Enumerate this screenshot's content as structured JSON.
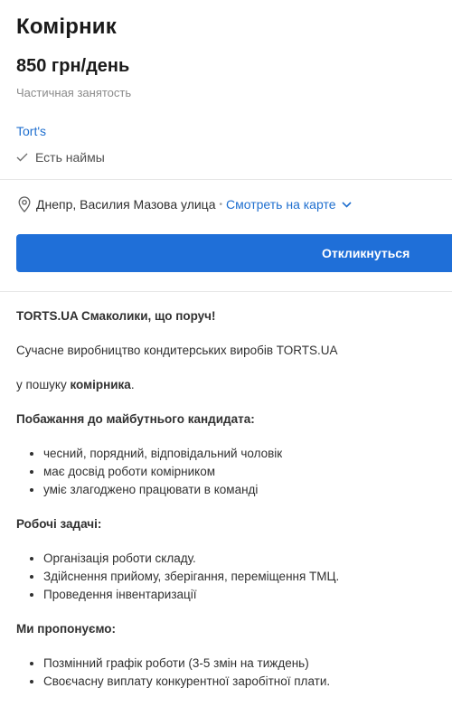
{
  "vacancy": {
    "title": "Комірник",
    "salary": "850 грн/день",
    "employment": "Частичная занятость",
    "company": "Tort's",
    "hires_status": "Есть наймы"
  },
  "location": {
    "address": "Днепр, Василия Мазова улица",
    "separator": "•",
    "map_link": "Смотреть на карте"
  },
  "apply_button": {
    "label": "Откликнуться"
  },
  "description": {
    "intro_heading": "TORTS.UA Смаколики, що поруч!",
    "intro_text": "Сучасне виробництво кондитерських виробів TORTS.UA",
    "search_prefix": "у пошуку ",
    "search_bold": "комірника",
    "search_suffix": ".",
    "wishes_heading": "Побажання до майбутнього кандидата:",
    "wishes": [
      "чесний, порядний, відповідальний чоловік",
      "має досвід роботи комірником",
      "уміє злагоджено працювати в команді"
    ],
    "tasks_heading": "Робочі задачі:",
    "tasks": [
      "Організація роботи складу.",
      "Здійснення прийому, зберігання, переміщення ТМЦ.",
      "Проведення інвентаризації"
    ],
    "offer_heading": "Ми пропонуємо:",
    "offers": [
      "Позмінний графік роботи (3-5 змін на тиждень)",
      "Своєчасну виплату конкурентної заробітної плати."
    ]
  },
  "colors": {
    "accent": "#1f6fd8",
    "link": "#1f6fcf",
    "muted": "#8a8a8a",
    "divider": "#e6e6e6"
  },
  "icons": [
    "check-icon",
    "location-pin-icon",
    "chevron-down-icon"
  ]
}
